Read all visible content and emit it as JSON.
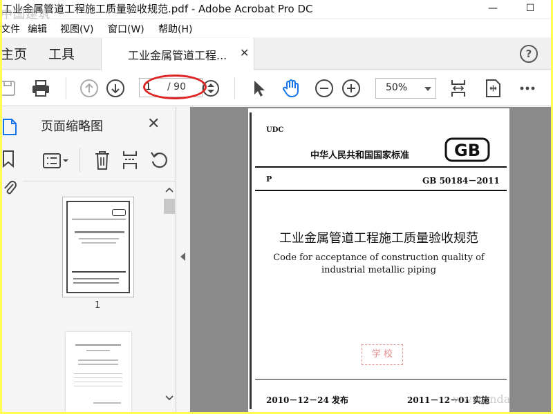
{
  "window": {
    "title": "工业金属管道工程施工质量验收规范.pdf - Adobe Acrobat Pro DC",
    "watermark_overlay": "中国建筑",
    "minimize_glyph": "—",
    "close_glyph": "☐"
  },
  "menu": {
    "items": [
      "文件",
      "编辑",
      "视图(V)",
      "窗口(W)",
      "帮助(H)"
    ]
  },
  "tabs": {
    "home": "主页",
    "tools": "工具",
    "document": "工业金属管道工程...",
    "close_glyph": "✕",
    "help_glyph": "?"
  },
  "toolbar": {
    "page_current": "1",
    "page_total": "/ 90",
    "zoom": "50%",
    "icons": [
      "save-icon",
      "print-icon",
      "prev-page-icon",
      "next-page-icon",
      "page-stepper-icon",
      "select-cursor-icon",
      "hand-icon",
      "zoom-out-icon",
      "zoom-in-icon",
      "fit-width-icon",
      "fullscreen-icon",
      "more-icon"
    ],
    "accent": "#1473e6"
  },
  "thumbs_panel": {
    "title": "页面缩略图",
    "close_glyph": "✕",
    "thumb1_label": "1",
    "icons": [
      "options-icon",
      "delete-icon",
      "extract-icon",
      "rotate-icon"
    ]
  },
  "document": {
    "udc": "UDC",
    "standard_name": "中华人民共和国国家标准",
    "logo": "GB",
    "p_label": "P",
    "code": "GB 50184－2011",
    "title_zh": "工业金属管道工程施工质量验收规范",
    "title_en_line1": "Code for acceptance of construction quality of",
    "title_en_line2": "industrial metallic piping",
    "stamp_text": "学 校",
    "published": "2010－12－24 发布",
    "implemented": "2011－12－01 实施",
    "watermark": "www.cnda"
  }
}
